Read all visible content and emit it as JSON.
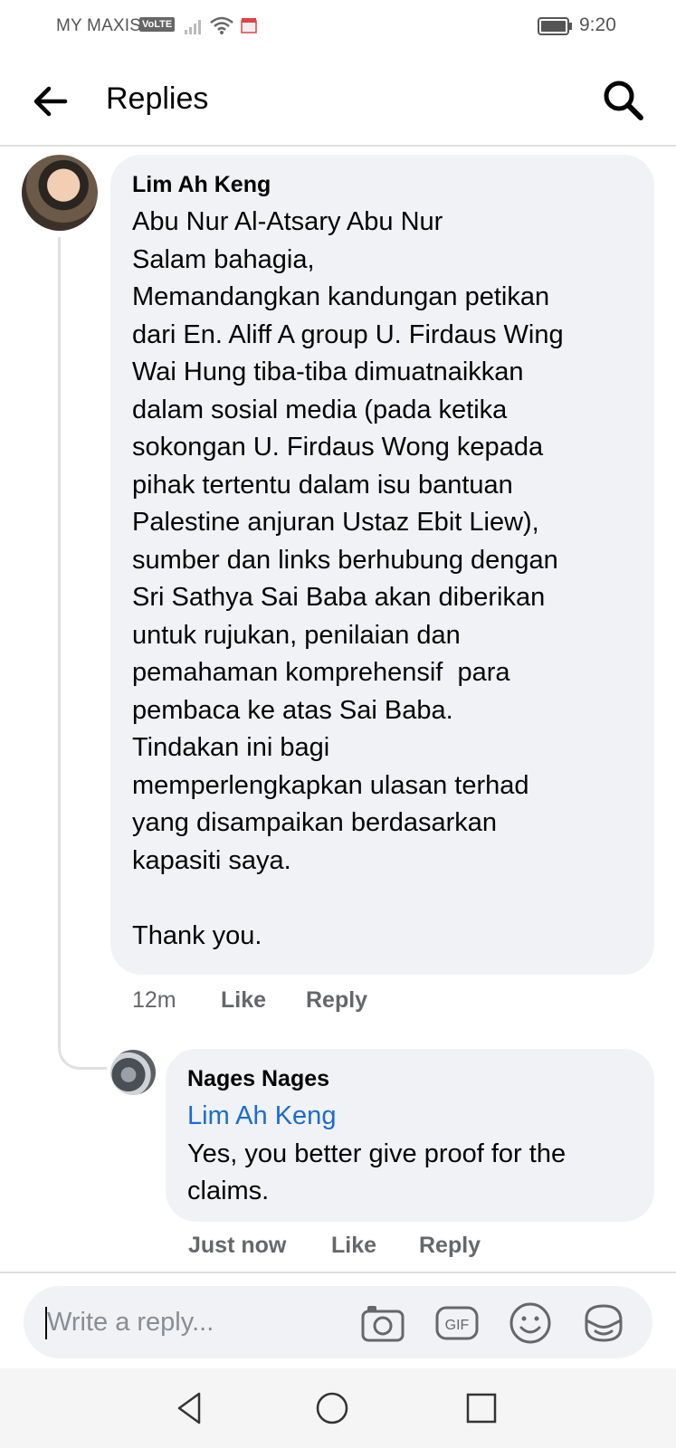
{
  "status_bar": {
    "carrier": "MY MAXIS",
    "volte": "VoLTE",
    "time": "9:20"
  },
  "header": {
    "title": "Replies",
    "back_icon": "arrow-left-icon",
    "search_icon": "search-icon"
  },
  "comments": [
    {
      "author": "Lim Ah Keng",
      "text": "Abu Nur Al-Atsary Abu Nur\nSalam bahagia,\nMemandangkan kandungan petikan\ndari En. Aliff A group U. Firdaus Wing\nWai Hung tiba-tiba dimuatnaikkan\ndalam sosial media (pada ketika\nsokongan U. Firdaus Wong kepada\npihak tertentu dalam isu bantuan\nPalestine anjuran Ustaz Ebit Liew),\nsumber dan links berhubung dengan\nSri Sathya Sai Baba akan diberikan\nuntuk rujukan, penilaian dan\npemahaman komprehensif  para\npembaca ke atas Sai Baba.\nTindakan ini bagi\nmemperlengkapkan ulasan terhad\nyang disampaikan berdasarkan\nkapasiti saya.\n\nThank you.",
      "time": "12m",
      "like_label": "Like",
      "reply_label": "Reply"
    },
    {
      "author": "Nages Nages",
      "mention": "Lim Ah Keng",
      "text": "Yes, you better give proof for the\nclaims.",
      "time": "Just now",
      "like_label": "Like",
      "reply_label": "Reply"
    }
  ],
  "composer": {
    "placeholder": "Write a reply...",
    "icons": [
      "camera-icon",
      "gif-icon",
      "emoji-icon",
      "sticker-icon"
    ]
  },
  "navbar": {
    "icons": [
      "back-triangle-icon",
      "home-circle-icon",
      "recents-square-icon"
    ]
  }
}
